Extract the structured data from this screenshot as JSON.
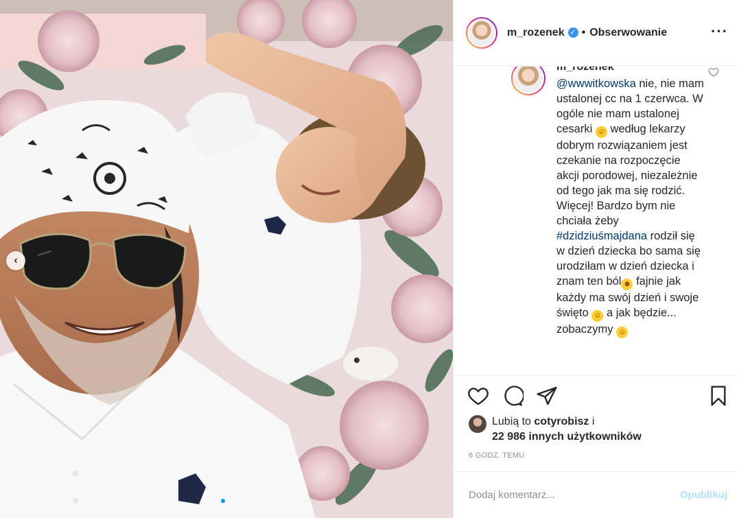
{
  "post": {
    "username": "m_rozenek",
    "follow_label": "Obserwowanie",
    "separator": "•",
    "more_icon": "more-options-icon",
    "verified_icon": "verified-badge-icon"
  },
  "comment": {
    "username": "m_rozenek",
    "mention": "@wwwitkowska",
    "text_1": " nie, nie mam ustalonej cc na 1 czerwca. W ogóle nie mam ustalonej cesarki ",
    "text_2": " według lekarzy dobrym rozwiązaniem jest czekanie na rozpoczęcie akcji porodowej, niezależnie od tego jak ma się rodzić. Więcej! Bardzo bym nie chciała żeby ",
    "hashtag": "#dzidziuśmajdana",
    "text_3": " rodził się w dzień dziecka bo sama się urodziłam w dzień dziecka i znam ten ból",
    "text_4": " fajnie jak każdy ma swój dzień i swoje święto ",
    "text_5": " a jak będzie... zobaczymy "
  },
  "actions": {
    "like_icon": "heart-icon",
    "comment_icon": "comment-icon",
    "share_icon": "share-icon",
    "save_icon": "bookmark-icon"
  },
  "likes": {
    "prefix": "Lubią to ",
    "first_user": "cotyrobisz",
    "joiner": " i",
    "count_text": "22 986 innych użytkowników"
  },
  "timestamp": "6 GODZ. TEMU",
  "add_comment": {
    "placeholder": "Dodaj komentarz...",
    "publish_label": "Opublikuj"
  },
  "carousel": {
    "prev_icon": "chevron-left-icon",
    "slides": 2,
    "active_slide": 2
  },
  "colors": {
    "accent": "#0095f6",
    "link": "#00376b",
    "verified": "#3897f0",
    "publish_disabled": "#b2dffc",
    "muted": "#8e8e8e"
  }
}
